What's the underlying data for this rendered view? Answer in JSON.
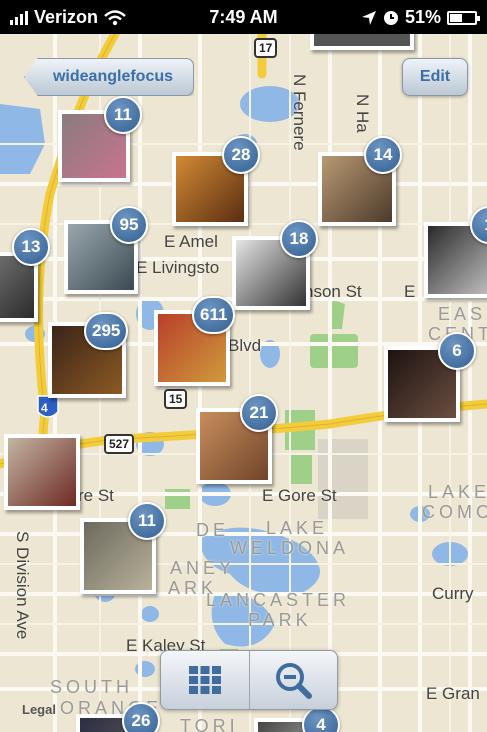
{
  "status_bar": {
    "carrier": "Verizon",
    "time": "7:49 AM",
    "battery": "51%",
    "battery_level": 0.51
  },
  "nav": {
    "back_label": "wideanglefocus",
    "edit_label": "Edit"
  },
  "map": {
    "street_labels": [
      "N Fernere",
      "N Ha",
      "E Amel",
      "E Livingsto",
      "nson St",
      "E",
      "Blvd",
      "re St",
      "E Gore St",
      "S Division Ave",
      "Curry",
      "E Kaley St",
      "E Gran"
    ],
    "area_labels": [
      "EAS",
      "CENT",
      "LAKE",
      "COMO",
      "LAKE",
      "WELDONA",
      "LANCASTER",
      "PARK",
      "SOUTH",
      "ORANGE",
      "TORI",
      "DE",
      "ANEY",
      "ARK"
    ],
    "route_shields": [
      "17",
      "15",
      "527",
      "4"
    ],
    "legal": "Legal"
  },
  "clusters": [
    {
      "count": "11",
      "colors": [
        "#8a7b7e",
        "#c9748f"
      ]
    },
    {
      "count": "28",
      "colors": [
        "#d28a34",
        "#5a2e12"
      ]
    },
    {
      "count": "14",
      "colors": [
        "#b79a72",
        "#4d3a2c"
      ]
    },
    {
      "count": "95",
      "colors": [
        "#9aa7ad",
        "#3b4a52"
      ]
    },
    {
      "count": "18",
      "colors": [
        "#e5e5e5",
        "#333333"
      ]
    },
    {
      "count": "13",
      "colors": [
        "#6d6d6d",
        "#2b2b2b"
      ]
    },
    {
      "count": "1",
      "colors": [
        "#2a2a2a",
        "#bfbfbf"
      ]
    },
    {
      "count": "295",
      "colors": [
        "#3a2418",
        "#8c5a24"
      ]
    },
    {
      "count": "611",
      "colors": [
        "#b8402a",
        "#d09a3c"
      ]
    },
    {
      "count": "6",
      "colors": [
        "#1d1210",
        "#6b4e40"
      ]
    },
    {
      "count": "21",
      "colors": [
        "#c98d5c",
        "#70442a"
      ]
    },
    {
      "count": "",
      "colors": [
        "#c4b5a4",
        "#6d2a22"
      ]
    },
    {
      "count": "11",
      "colors": [
        "#6c6a5e",
        "#b9b19a"
      ]
    },
    {
      "count": "26",
      "colors": [
        "#2c2c44",
        "#555"
      ]
    },
    {
      "count": "4",
      "colors": [
        "#444",
        "#999"
      ]
    }
  ],
  "toolbar": {
    "grid_icon": "grid-icon",
    "zoom_out_icon": "zoom-out-icon"
  },
  "colors": {
    "badge": "#3f6da0",
    "nav_text": "#3b6fa6",
    "map_bg": "#ede6d2",
    "water": "#8fb8e6",
    "park": "#9fd08a",
    "highway": "#f2cc3a"
  }
}
